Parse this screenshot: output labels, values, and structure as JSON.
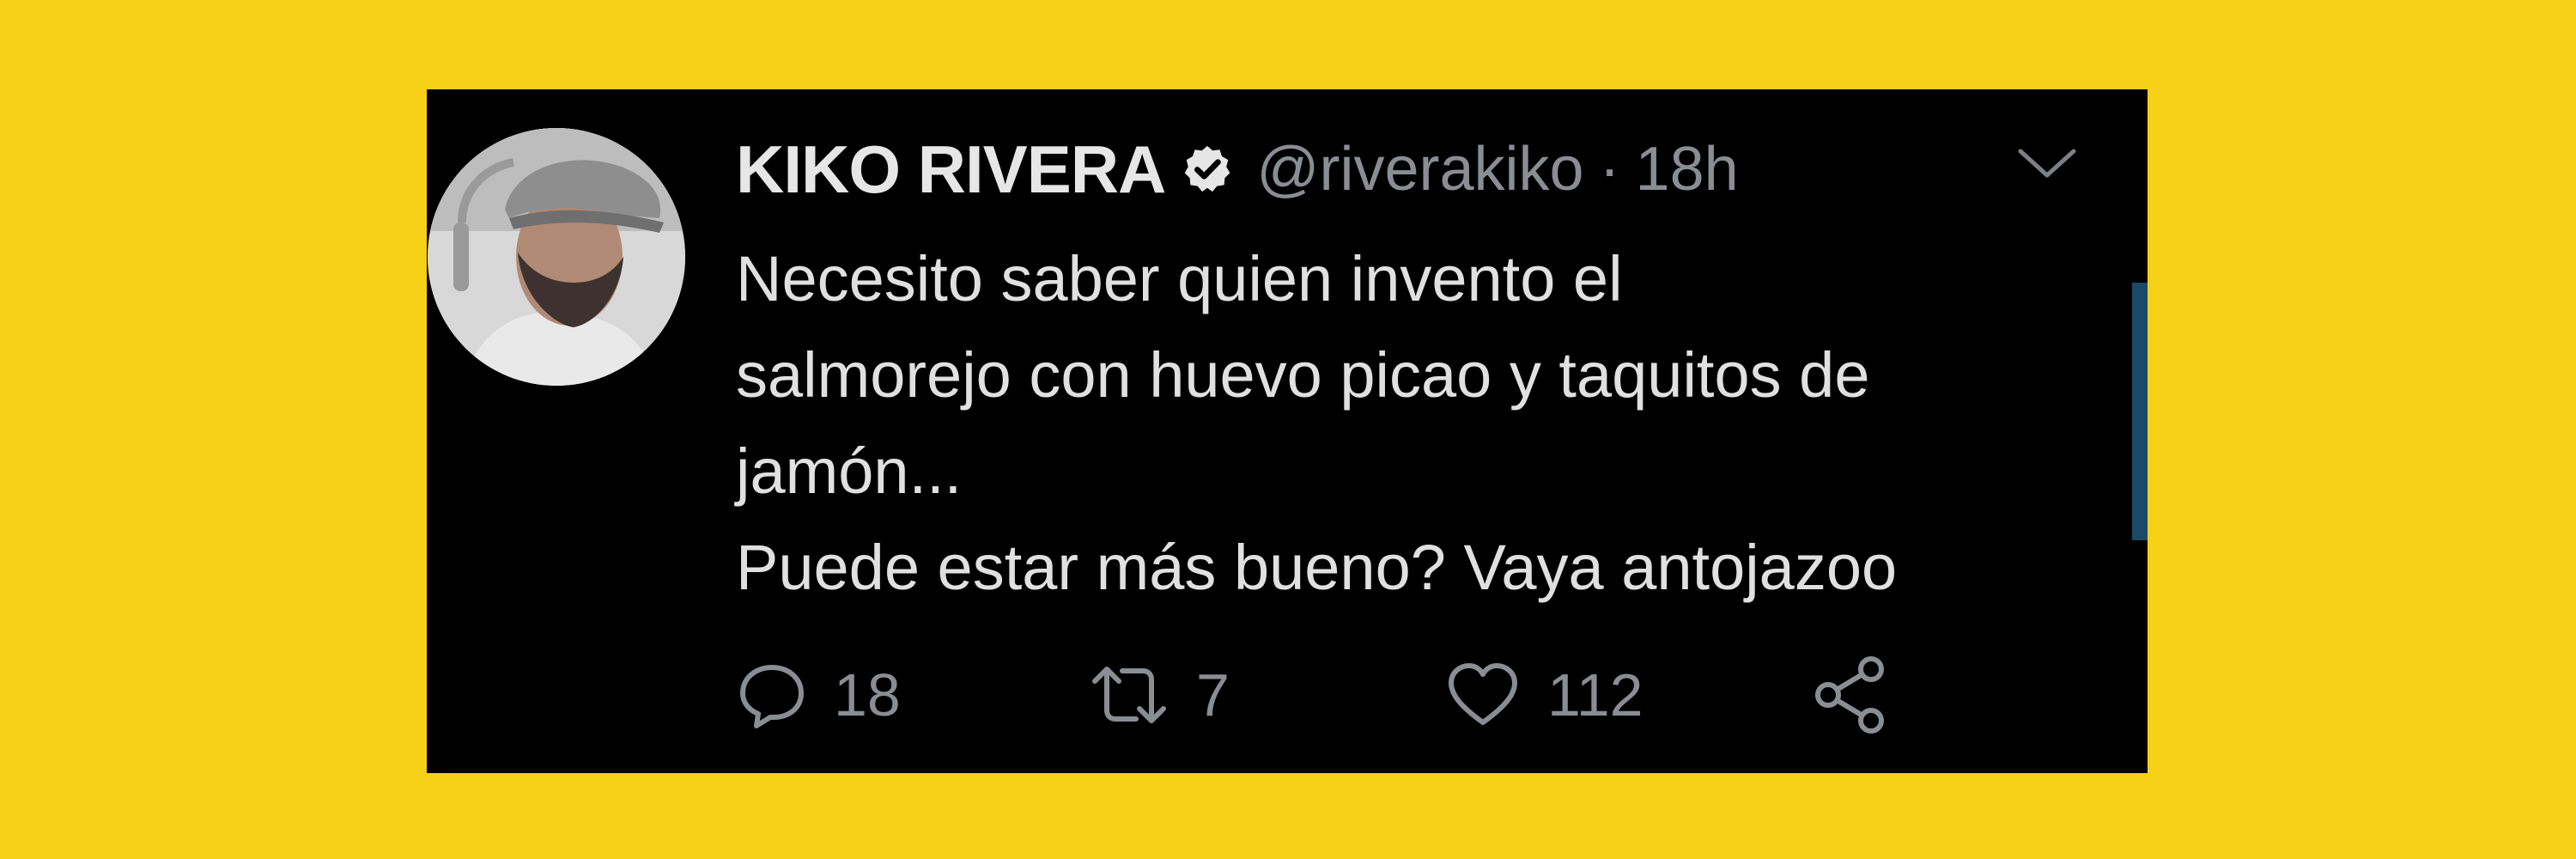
{
  "tweet": {
    "display_name": "KIKO RIVERA",
    "handle": "@riverakiko",
    "separator": "·",
    "timestamp": "18h",
    "text_lines": [
      "Necesito saber quien invento el",
      "salmorejo con huevo picao y taquitos de",
      "jamón...",
      "Puede estar más bueno? Vaya antojazoo"
    ],
    "actions": {
      "replies": "18",
      "retweets": "7",
      "likes": "112"
    },
    "icons": {
      "verified": "verified-badge-icon",
      "menu": "chevron-down-icon",
      "reply": "reply-icon",
      "retweet": "retweet-icon",
      "like": "heart-icon",
      "share": "share-icon"
    }
  },
  "colors": {
    "background": "#f6d017",
    "card": "#000000",
    "text": "#e0e0e0",
    "muted": "#8a8d91"
  }
}
